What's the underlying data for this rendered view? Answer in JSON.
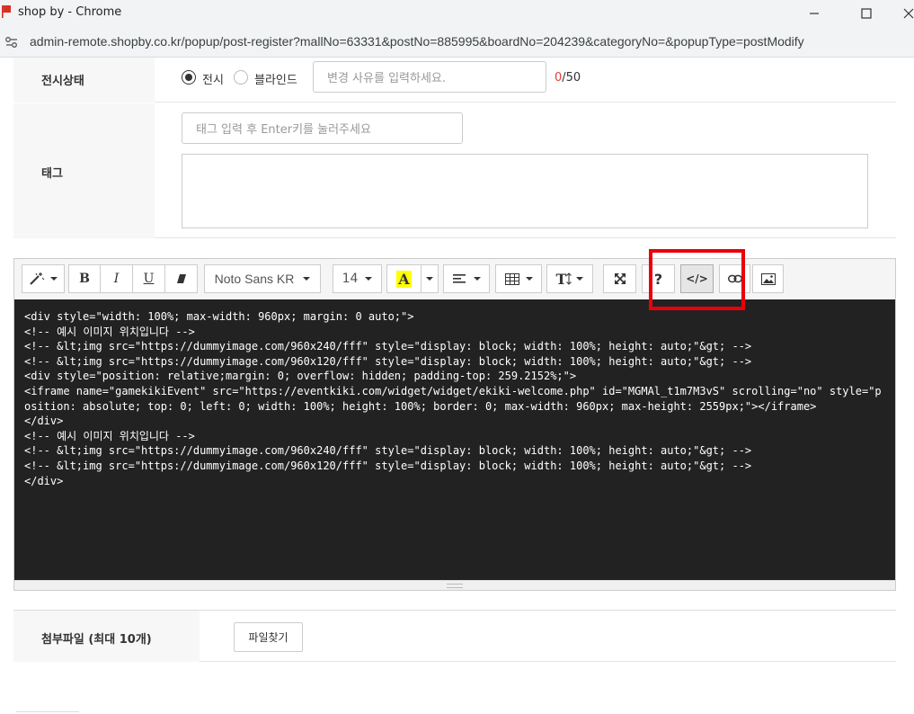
{
  "window": {
    "title": "shop by - Chrome",
    "url": "admin-remote.shopby.co.kr/popup/post-register?mallNo=63331&postNo=885995&boardNo=204239&categoryNo=&popupType=postModify"
  },
  "display_status": {
    "label": "전시상태",
    "option_show": "전시",
    "option_blind": "블라인드",
    "selected": "전시",
    "reason_placeholder": "변경 사유를 입력하세요.",
    "count_current": "0",
    "count_max": "/50"
  },
  "tag": {
    "label": "태그",
    "input_placeholder": "태그 입력 후 Enter키를 눌러주세요"
  },
  "editor": {
    "toolbar": {
      "font_name": "Noto Sans KR",
      "font_size": "14",
      "bold": "B",
      "italic": "I",
      "underline": "U",
      "help": "?",
      "code_view": "</>",
      "color_letter": "A",
      "text_height": "T"
    },
    "source_lines": [
      "<div style=\"width: 100%; max-width: 960px; margin: 0 auto;\">",
      "<!-- 예시 이미지 위치입니다 -->",
      "<!-- &lt;img src=\"https://dummyimage.com/960x240/fff\" style=\"display: block; width: 100%; height: auto;\"&gt; -->",
      "<!-- &lt;img src=\"https://dummyimage.com/960x120/fff\" style=\"display: block; width: 100%; height: auto;\"&gt; -->",
      "<div style=\"position: relative;margin: 0; overflow: hidden; padding-top: 259.2152%;\">",
      "<iframe name=\"gamekikiEvent\" src=\"https://eventkiki.com/widget/widget/ekiki-welcome.php\" id=\"MGMAl_t1m7M3vS\" scrolling=\"no\" style=\"position: absolute; top: 0; left: 0; width: 100%; height: 100%; border: 0; max-width: 960px; max-height: 2559px;\"></iframe>",
      "</div>",
      "<!-- 예시 이미지 위치입니다 -->",
      "<!-- &lt;img src=\"https://dummyimage.com/960x240/fff\" style=\"display: block; width: 100%; height: auto;\"&gt; -->",
      "<!-- &lt;img src=\"https://dummyimage.com/960x120/fff\" style=\"display: block; width: 100%; height: auto;\"&gt; -->",
      "</div>"
    ]
  },
  "attachments": {
    "label": "첨부파일 (최대 10개)",
    "button": "파일찾기"
  },
  "colors": {
    "highlight": "#e8000b",
    "code_bg": "#222222",
    "counter_current": "#e53935"
  }
}
